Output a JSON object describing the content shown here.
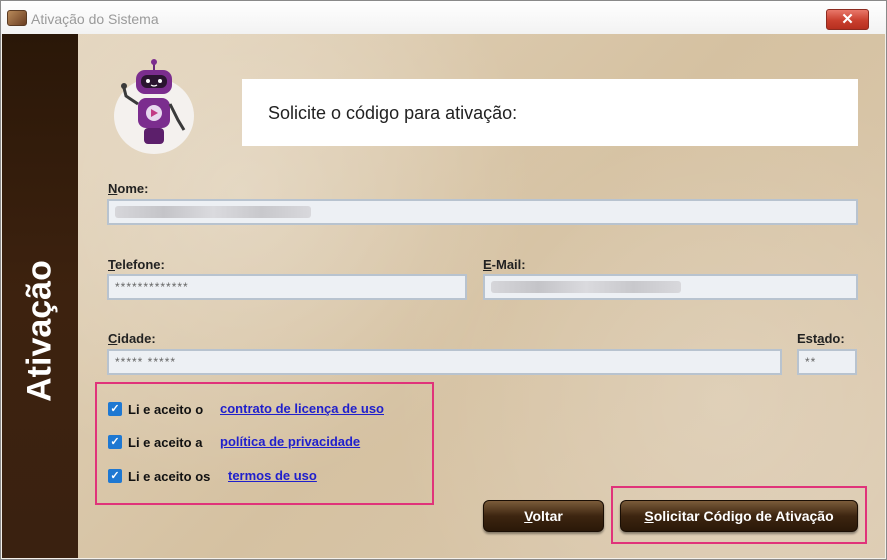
{
  "window": {
    "title": "Ativação do Sistema",
    "close_glyph": "✕"
  },
  "sidebar": {
    "label": "Ativação"
  },
  "header": {
    "text": "Solicite o código para ativação:"
  },
  "form": {
    "nome": {
      "label_u": "N",
      "label_rest": "ome:",
      "value": ""
    },
    "telefone": {
      "label_u": "T",
      "label_rest": "elefone:",
      "value": "*************"
    },
    "email": {
      "label_u": "E",
      "label_rest": "-Mail:",
      "value": ""
    },
    "cidade": {
      "label_u": "C",
      "label_rest": "idade:",
      "value": "***** *****"
    },
    "estado": {
      "label_pre": "Est",
      "label_u": "a",
      "label_rest": "do:",
      "value": "**"
    }
  },
  "agreements": [
    {
      "text": "Li e aceito o",
      "link": "contrato de licença de uso",
      "checked": true
    },
    {
      "text": "Li e aceito a",
      "link": "política de privacidade",
      "checked": true
    },
    {
      "text": "Li e aceito os",
      "link": "termos de uso",
      "checked": true
    }
  ],
  "buttons": {
    "voltar": {
      "u": "V",
      "rest": "oltar"
    },
    "solicitar": {
      "u": "S",
      "rest": "olicitar Código de Ativação"
    }
  },
  "icons": {
    "checkbox": "check-icon",
    "app": "app-icon",
    "robot": "robot-mascot"
  },
  "colors": {
    "accent_highlight": "#e0337a",
    "sidebar": "#3d220f",
    "link": "#2020cc",
    "checkbox": "#1e78d2"
  }
}
